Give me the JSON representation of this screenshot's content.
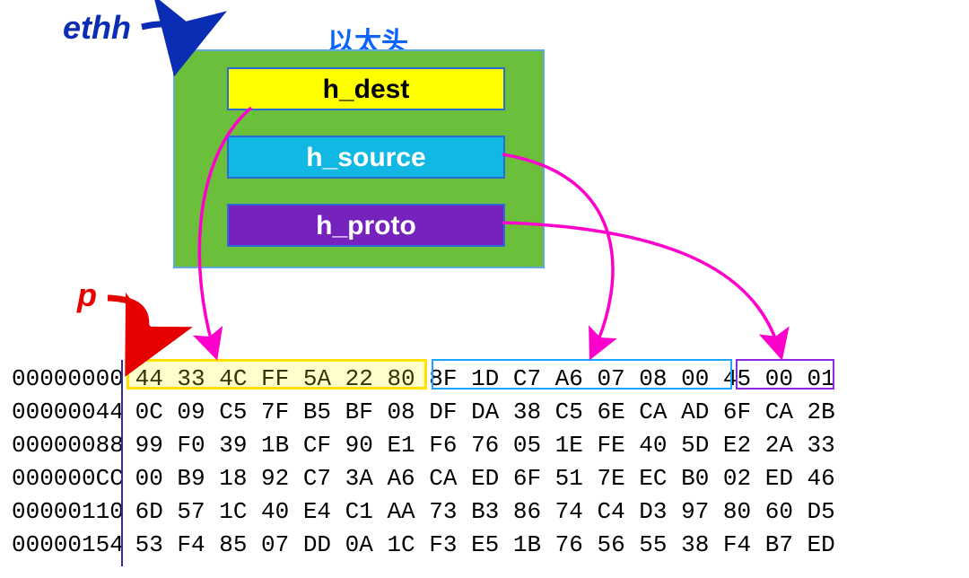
{
  "labels": {
    "ethh": "ethh",
    "p": "p",
    "title": "以太头"
  },
  "fields": {
    "dest": "h_dest",
    "source": "h_source",
    "proto": "h_proto"
  },
  "hexdump": {
    "offsets": [
      "00000000",
      "00000044",
      "00000088",
      "000000CC",
      "00000110",
      "00000154"
    ],
    "rows": [
      [
        "44",
        "33",
        "4C",
        "FF",
        "5A",
        "22",
        "80",
        "8F",
        "1D",
        "C7",
        "A6",
        "07",
        "08",
        "00",
        "45",
        "00",
        "01"
      ],
      [
        "0C",
        "09",
        "C5",
        "7F",
        "B5",
        "BF",
        "08",
        "DF",
        "DA",
        "38",
        "C5",
        "6E",
        "CA",
        "AD",
        "6F",
        "CA",
        "2B"
      ],
      [
        "99",
        "F0",
        "39",
        "1B",
        "CF",
        "90",
        "E1",
        "F6",
        "76",
        "05",
        "1E",
        "FE",
        "40",
        "5D",
        "E2",
        "2A",
        "33"
      ],
      [
        "00",
        "B9",
        "18",
        "92",
        "C7",
        "3A",
        "A6",
        "CA",
        "ED",
        "6F",
        "51",
        "7E",
        "EC",
        "B0",
        "02",
        "ED",
        "46"
      ],
      [
        "6D",
        "57",
        "1C",
        "40",
        "E4",
        "C1",
        "AA",
        "73",
        "B3",
        "86",
        "74",
        "C4",
        "D3",
        "97",
        "80",
        "60",
        "D5"
      ],
      [
        "53",
        "F4",
        "85",
        "07",
        "DD",
        "0A",
        "1C",
        "F3",
        "E5",
        "1B",
        "76",
        "56",
        "55",
        "38",
        "F4",
        "B7",
        "ED"
      ]
    ],
    "highlights": {
      "h_dest": {
        "row": 0,
        "start": 0,
        "len": 6
      },
      "h_source": {
        "row": 0,
        "start": 6,
        "len": 6
      },
      "h_proto": {
        "row": 0,
        "start": 12,
        "len": 2
      }
    }
  },
  "colors": {
    "struct_bg": "#6bbf3a",
    "field_dest_bg": "#ffff00",
    "field_source_bg": "#12b8e4",
    "field_proto_bg": "#7622bd",
    "ethh_label": "#0a2db3",
    "p_label": "#e60000",
    "arrow_pink": "#ff00cc",
    "arrow_blue": "#0a2db3",
    "arrow_red": "#e60000",
    "vline": "#303096"
  }
}
